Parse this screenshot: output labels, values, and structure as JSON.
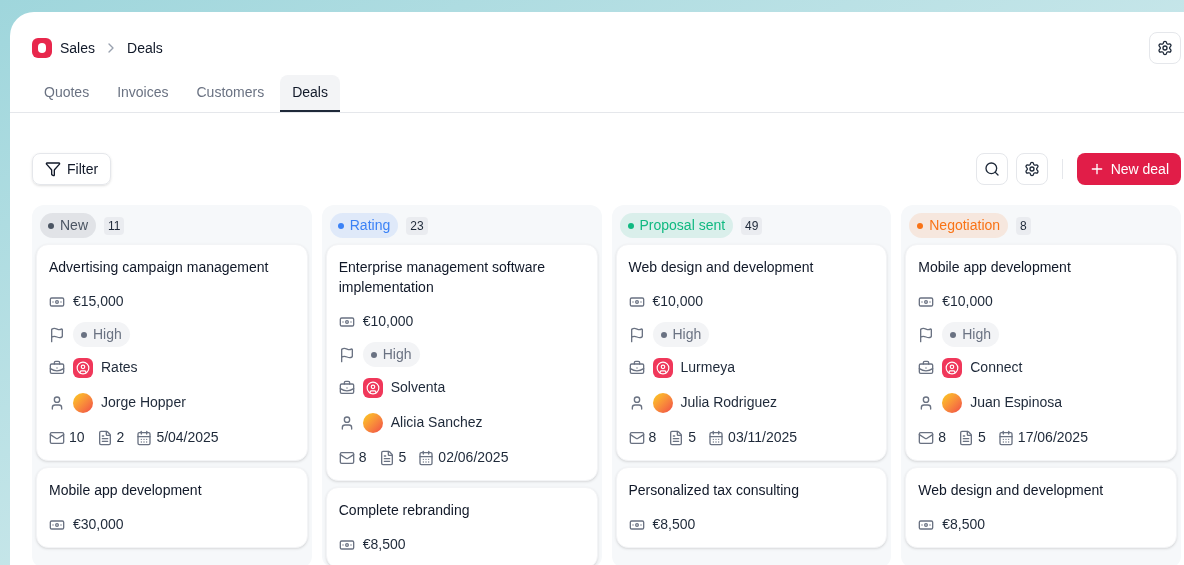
{
  "breadcrumb": {
    "app": "Sales",
    "page": "Deals"
  },
  "tabs": [
    {
      "label": "Quotes",
      "selected": false
    },
    {
      "label": "Invoices",
      "selected": false
    },
    {
      "label": "Customers",
      "selected": false
    },
    {
      "label": "Deals",
      "selected": true
    }
  ],
  "toolbar": {
    "filter": "Filter",
    "new_button": "New deal"
  },
  "columns": [
    {
      "name": "New",
      "count": "11",
      "color": "#4b5563",
      "cards": [
        {
          "title": "Advertising campaign management",
          "amount": "€15,000",
          "priority": "High",
          "company": "Rates",
          "owner": "Jorge Hopper",
          "emails": "10",
          "documents": "2",
          "date": "5/04/2025"
        },
        {
          "title": "Mobile app development",
          "amount": "€30,000"
        }
      ]
    },
    {
      "name": "Rating",
      "count": "23",
      "color": "#3b82f6",
      "cards": [
        {
          "title": "Enterprise management software implementation",
          "amount": "€10,000",
          "priority": "High",
          "company": "Solventa",
          "owner": "Alicia Sanchez",
          "emails": "8",
          "documents": "5",
          "date": "02/06/2025"
        },
        {
          "title": "Complete rebranding",
          "amount": "€8,500"
        }
      ]
    },
    {
      "name": "Proposal sent",
      "count": "49",
      "color": "#10b981",
      "cards": [
        {
          "title": "Web design and development",
          "amount": "€10,000",
          "priority": "High",
          "company": "Lurmeya",
          "owner": "Julia Rodriguez",
          "emails": "8",
          "documents": "5",
          "date": "03/11/2025"
        },
        {
          "title": "Personalized tax consulting",
          "amount": "€8,500"
        }
      ]
    },
    {
      "name": "Negotiation",
      "count": "8",
      "color": "#f97316",
      "cards": [
        {
          "title": "Mobile app development",
          "amount": "€10,000",
          "priority": "High",
          "company": "Connect",
          "owner": "Juan Espinosa",
          "emails": "8",
          "documents": "5",
          "date": "17/06/2025"
        },
        {
          "title": "Web design and development",
          "amount": "€8,500"
        }
      ]
    }
  ]
}
